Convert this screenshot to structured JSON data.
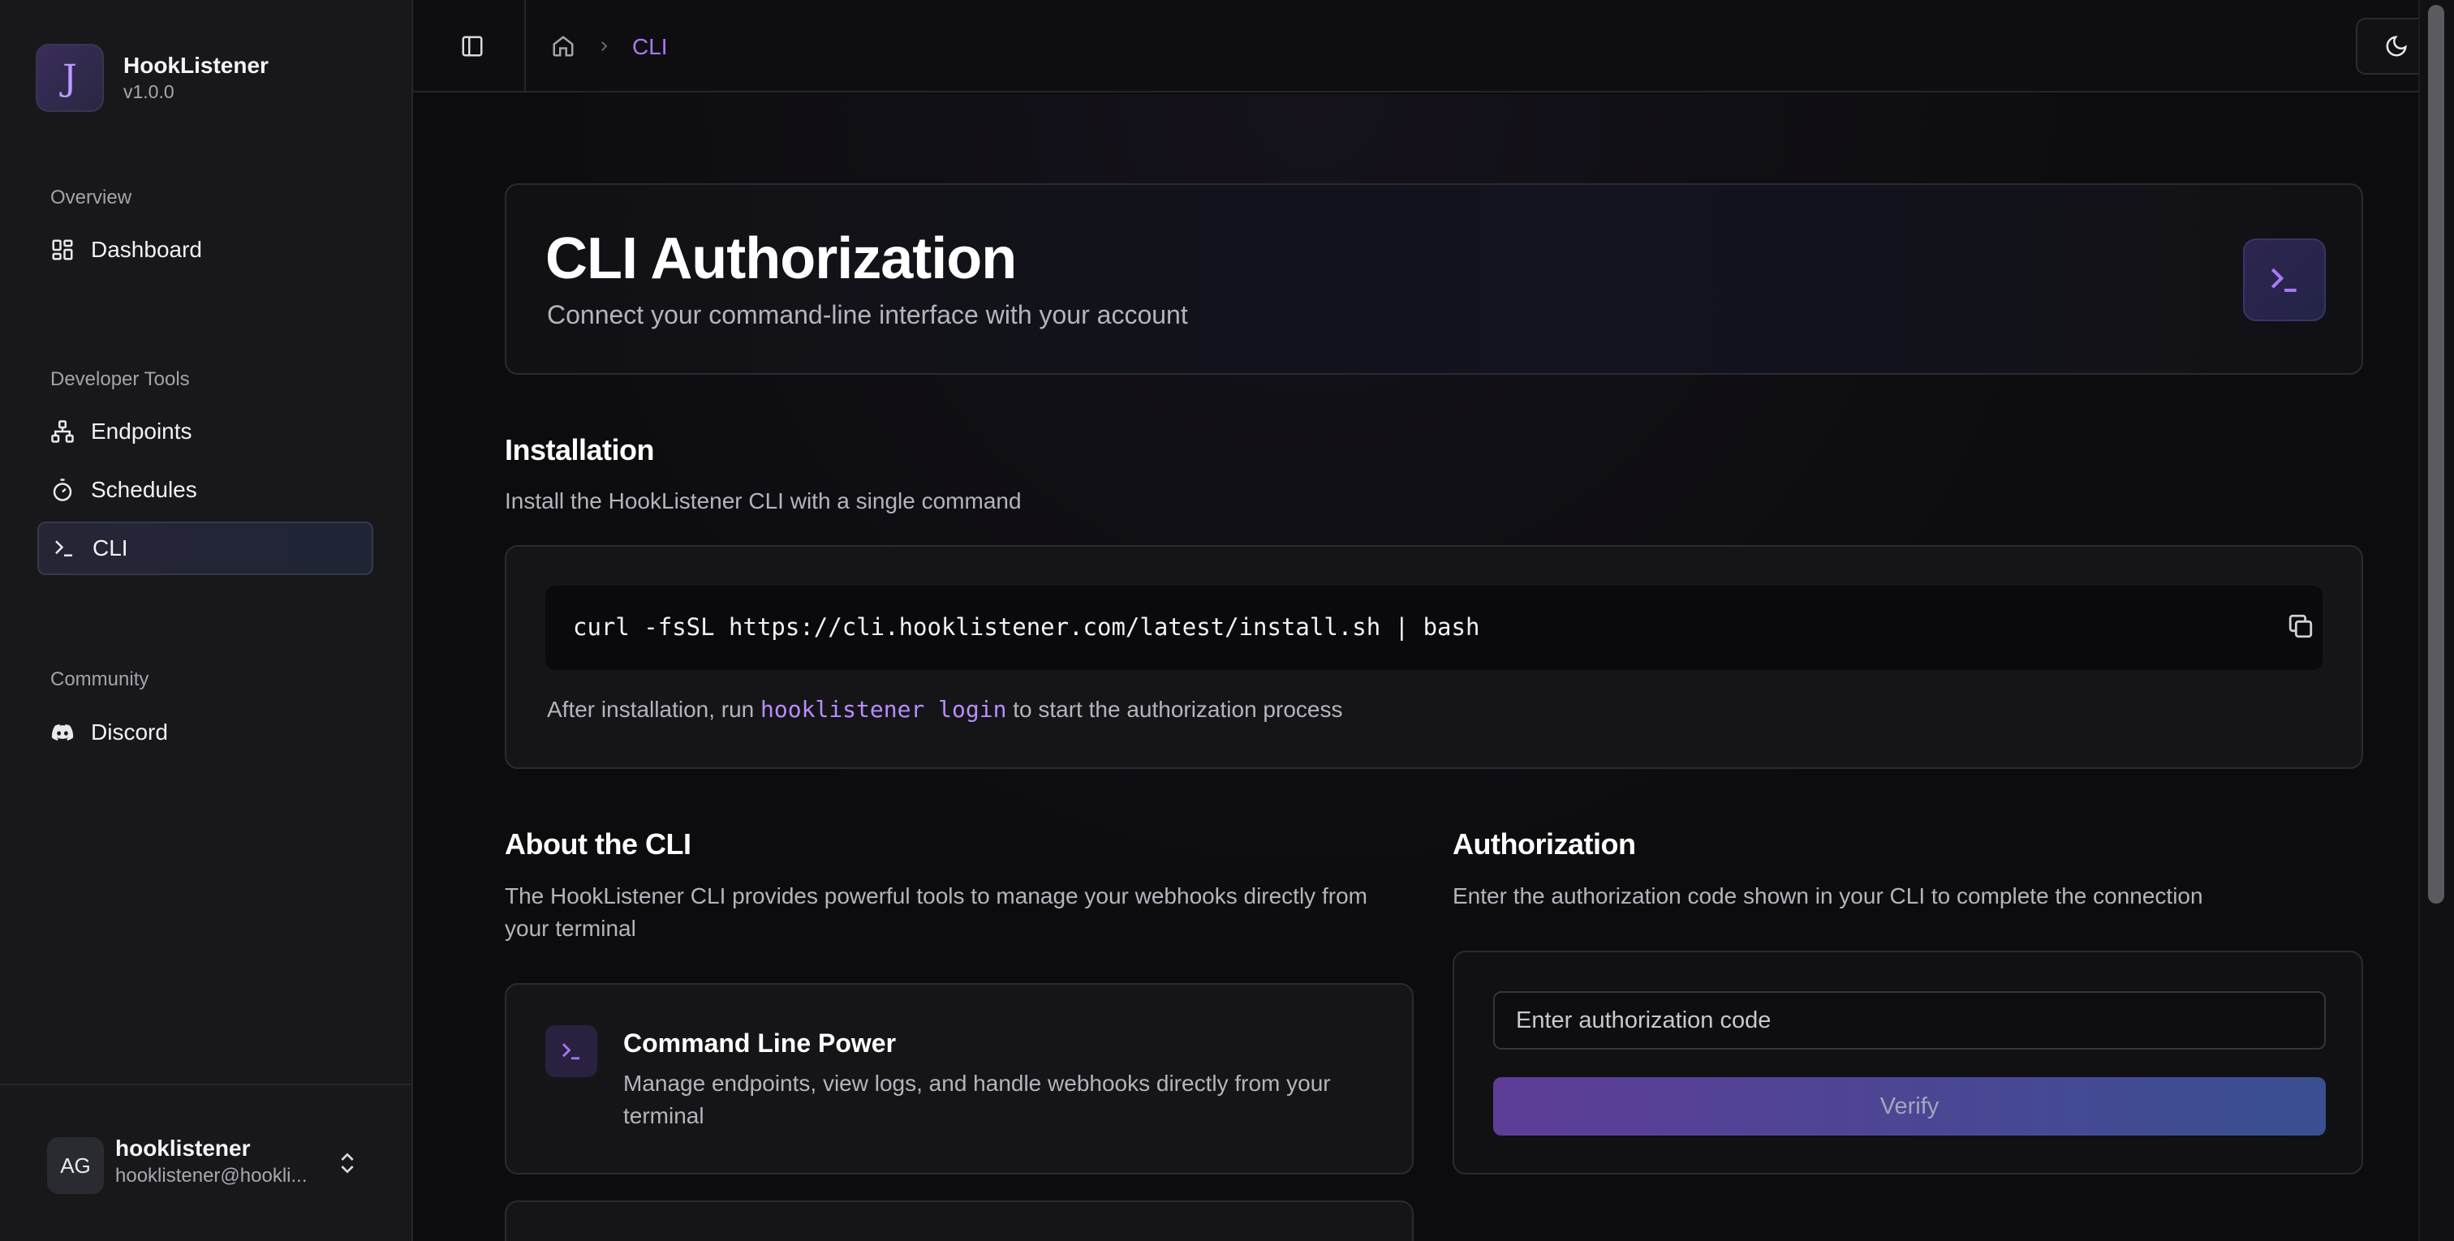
{
  "app": {
    "name": "HookListener",
    "version": "v1.0.0",
    "logo_letter": "J"
  },
  "sidebar": {
    "groups": [
      {
        "label": "Overview",
        "items": [
          {
            "label": "Dashboard",
            "icon": "dashboard-icon"
          }
        ]
      },
      {
        "label": "Developer Tools",
        "items": [
          {
            "label": "Endpoints",
            "icon": "endpoints-icon"
          },
          {
            "label": "Schedules",
            "icon": "timer-icon"
          },
          {
            "label": "CLI",
            "icon": "terminal-icon",
            "active": true
          }
        ]
      },
      {
        "label": "Community",
        "items": [
          {
            "label": "Discord",
            "icon": "discord-icon"
          }
        ]
      }
    ],
    "user": {
      "initials": "AG",
      "name": "hooklistener",
      "email": "hooklistener@hookli..."
    }
  },
  "header": {
    "breadcrumb_current": "CLI"
  },
  "hero": {
    "title": "CLI Authorization",
    "subtitle": "Connect your command-line interface with your account"
  },
  "installation": {
    "title": "Installation",
    "description": "Install the HookListener CLI with a single command",
    "command": "curl -fsSL https://cli.hooklistener.com/latest/install.sh | bash",
    "note_before": "After installation, run ",
    "note_cmd": "hooklistener login",
    "note_after": " to start the authorization process"
  },
  "about": {
    "title": "About the CLI",
    "description": "The HookListener CLI provides powerful tools to manage your webhooks directly from your terminal",
    "features": [
      {
        "title": "Command Line Power",
        "description": "Manage endpoints, view logs, and handle webhooks directly from your terminal"
      }
    ]
  },
  "authorization": {
    "title": "Authorization",
    "description": "Enter the authorization code shown in your CLI to complete the connection",
    "input_placeholder": "Enter authorization code",
    "input_value": "",
    "verify_label": "Verify"
  },
  "colors": {
    "accent": "#a978f7",
    "sidebar_bg": "#18181b",
    "main_bg": "#0c0c0e"
  }
}
